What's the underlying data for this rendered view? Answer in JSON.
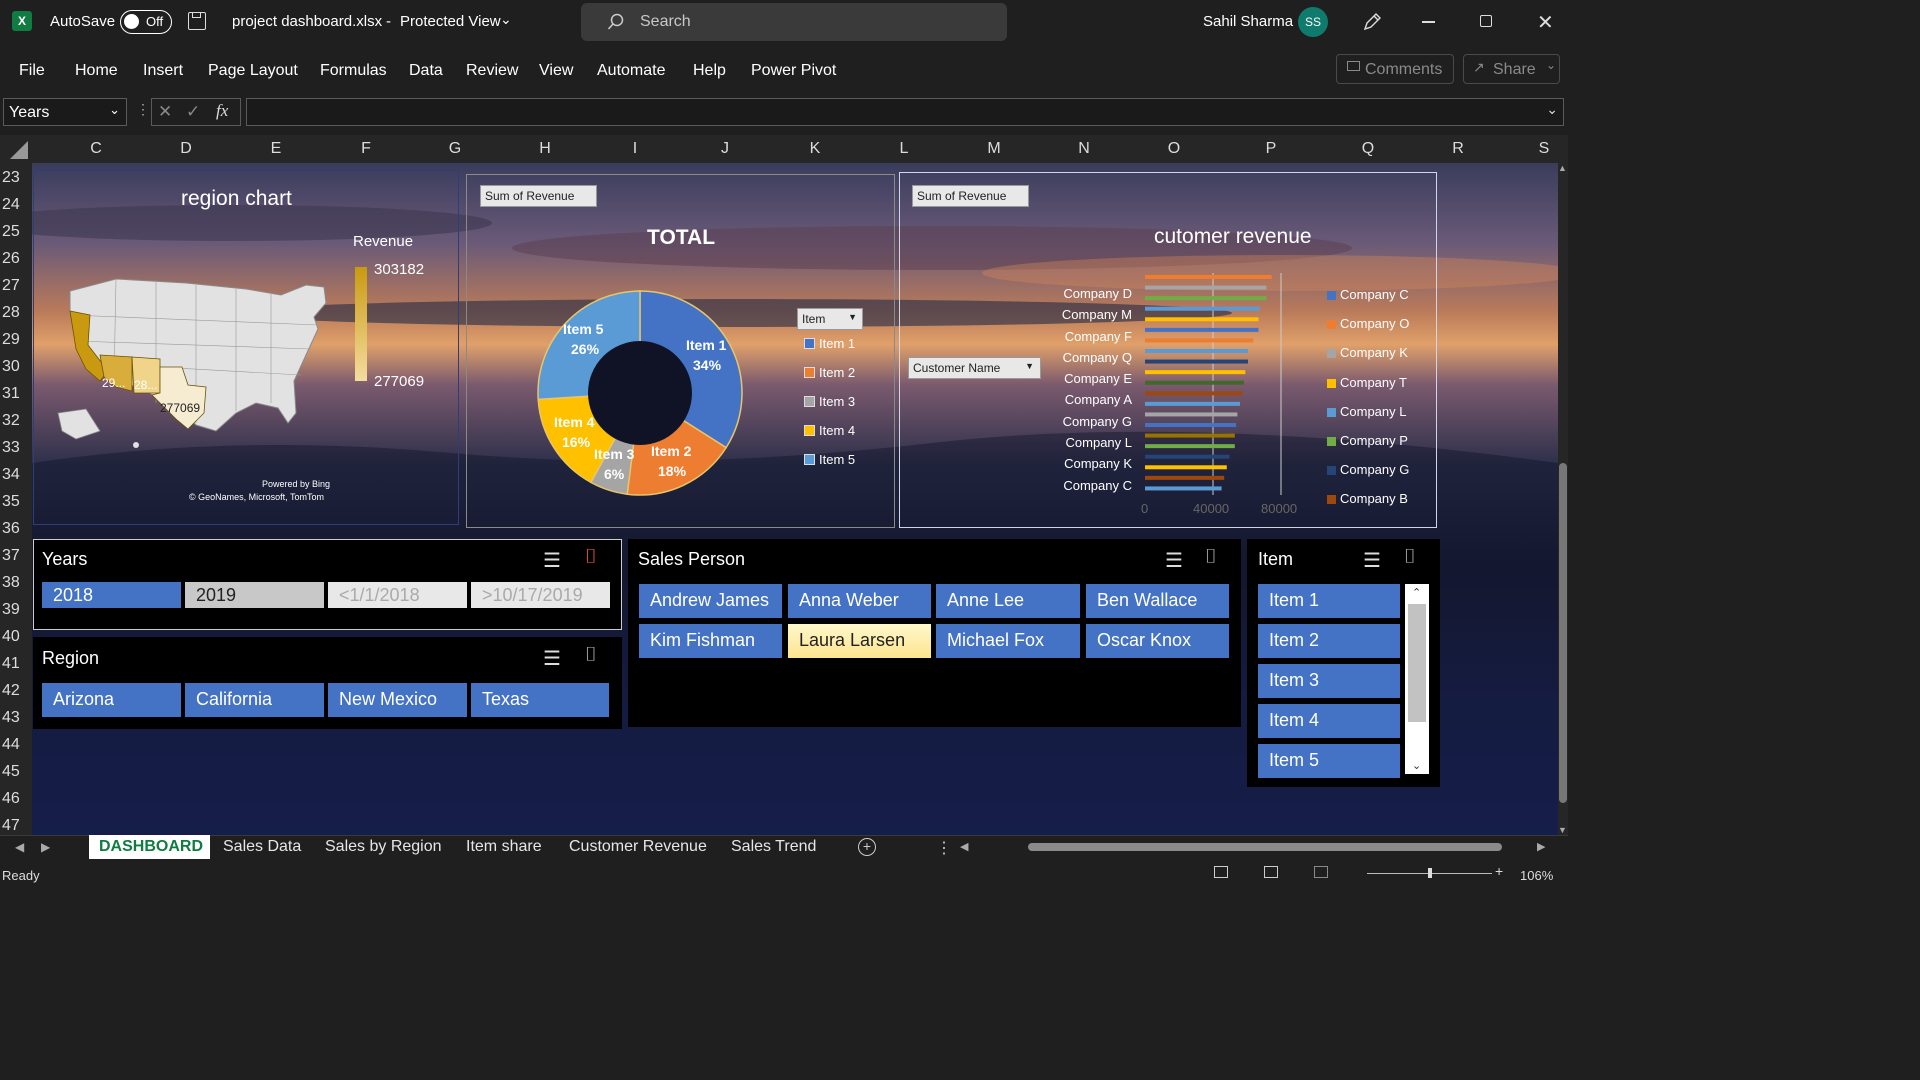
{
  "title_bar": {
    "autosave_label": "AutoSave",
    "autosave_state": "Off",
    "file_name": "project dashboard.xlsx",
    "separator": "-",
    "view_mode": "Protected View",
    "search_placeholder": "Search",
    "user_name": "Sahil Sharma",
    "user_initials": "SS"
  },
  "ribbon": {
    "tabs": [
      "File",
      "Home",
      "Insert",
      "Page Layout",
      "Formulas",
      "Data",
      "Review",
      "View",
      "Automate",
      "Help",
      "Power Pivot"
    ],
    "comments_label": "Comments",
    "share_label": "Share"
  },
  "formula_bar": {
    "name_box": "Years",
    "fx_label": "fx",
    "formula": ""
  },
  "columns": [
    "C",
    "D",
    "E",
    "F",
    "G",
    "H",
    "I",
    "J",
    "K",
    "L",
    "M",
    "N",
    "O",
    "P",
    "Q",
    "R",
    "S"
  ],
  "rows": [
    "23",
    "24",
    "25",
    "26",
    "27",
    "28",
    "29",
    "30",
    "31",
    "32",
    "33",
    "34",
    "35",
    "36",
    "37",
    "38",
    "39",
    "40",
    "41",
    "42",
    "43",
    "44",
    "45",
    "46",
    "47"
  ],
  "region_chart": {
    "title": "region chart",
    "legend_title": "Revenue",
    "max_value": "303182",
    "min_value": "277069",
    "map_labels": [
      "29...",
      "28...",
      "277069"
    ],
    "powered_by": "Powered by Bing",
    "copyright": "© GeoNames, Microsoft, TomTom"
  },
  "donut_chart": {
    "field_button": "Sum of Revenue",
    "title": "TOTAL",
    "filter_button": "Item",
    "legend": [
      "Item 1",
      "Item 2",
      "Item 3",
      "Item 4",
      "Item 5"
    ],
    "slice_labels": [
      {
        "name": "Item 1",
        "pct": "34%"
      },
      {
        "name": "Item 2",
        "pct": "18%"
      },
      {
        "name": "Item 3",
        "pct": "6%"
      },
      {
        "name": "Item 4",
        "pct": "16%"
      },
      {
        "name": "Item 5",
        "pct": "26%"
      }
    ]
  },
  "chart_data": {
    "type": "pie",
    "title": "TOTAL",
    "categories": [
      "Item 1",
      "Item 2",
      "Item 3",
      "Item 4",
      "Item 5"
    ],
    "values": [
      34,
      18,
      6,
      16,
      26
    ],
    "colors": [
      "#4472c4",
      "#ed7d31",
      "#a5a5a5",
      "#ffc000",
      "#5b9bd5"
    ]
  },
  "customer_chart": {
    "field_button": "Sum of Revenue",
    "title": "cutomer revenue",
    "filter_button": "Customer Name",
    "y_labels": [
      "Company D",
      "Company M",
      "Company F",
      "Company Q",
      "Company E",
      "Company A",
      "Company G",
      "Company L",
      "Company K",
      "Company C"
    ],
    "x_ticks": [
      "0",
      "40000",
      "80000"
    ],
    "legend": [
      "Company C",
      "Company O",
      "Company K",
      "Company T",
      "Company L",
      "Company P",
      "Company G",
      "Company B"
    ],
    "legend_colors": [
      "#4472c4",
      "#ed7d31",
      "#a5a5a5",
      "#ffc000",
      "#5b9bd5",
      "#70ad47",
      "#264478",
      "#9e480e"
    ],
    "bar_colors": [
      "#ed7d31",
      "#a5a5a5",
      "#70ad47",
      "#5b9bd5",
      "#ffc000",
      "#4472c4",
      "#ed7d31",
      "#5b9bd5",
      "#264478",
      "#ffc000",
      "#43682b",
      "#9e480e",
      "#5b9bd5",
      "#a5a5a5",
      "#4472c4",
      "#997300",
      "#70ad47",
      "#264478",
      "#ffc000",
      "#9e480e",
      "#5b9bd5"
    ],
    "bar_lengths": [
      0.96,
      0.92,
      0.92,
      0.87,
      0.86,
      0.86,
      0.82,
      0.78,
      0.78,
      0.76,
      0.75,
      0.74,
      0.72,
      0.7,
      0.69,
      0.68,
      0.68,
      0.64,
      0.62,
      0.6,
      0.58
    ]
  },
  "slicers": {
    "years": {
      "title": "Years",
      "items": [
        "2018",
        "2019",
        "<1/1/2018",
        ">10/17/2019"
      ]
    },
    "region": {
      "title": "Region",
      "items": [
        "Arizona",
        "California",
        "New Mexico",
        "Texas"
      ]
    },
    "sales_person": {
      "title": "Sales Person",
      "items": [
        "Andrew James",
        "Anna Weber",
        "Anne Lee",
        "Ben Wallace",
        "Kim Fishman",
        "Laura Larsen",
        "Michael Fox",
        "Oscar Knox"
      ]
    },
    "item": {
      "title": "Item",
      "items": [
        "Item 1",
        "Item 2",
        "Item 3",
        "Item 4",
        "Item 5"
      ]
    }
  },
  "sheet_tabs": [
    "DASHBOARD",
    "Sales Data",
    "Sales by Region",
    "Item share",
    "Customer Revenue",
    "Sales Trend"
  ],
  "status": {
    "left": "Ready",
    "zoom": "106%"
  }
}
